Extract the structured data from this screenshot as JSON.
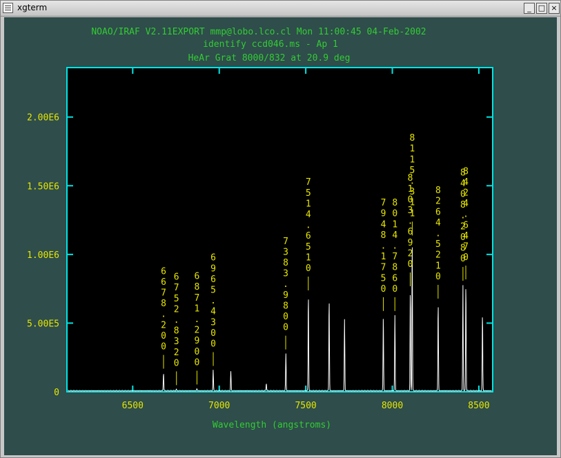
{
  "window": {
    "title": "xgterm",
    "buttons": [
      {
        "name": "minimize",
        "glyph": "_"
      },
      {
        "name": "maximize",
        "glyph": "□"
      },
      {
        "name": "close",
        "glyph": "×"
      }
    ]
  },
  "plot": {
    "header_lines": [
      "NOAO/IRAF V2.11EXPORT mmp@lobo.lco.cl Mon 11:00:45 04-Feb-2002",
      "identify ccd046.ms - Ap 1",
      "HeAr Grat 8000/832 at 20.9 deg"
    ],
    "xlabel": "Wavelength (angstroms)"
  },
  "chart_data": {
    "type": "line",
    "title": "HeAr Grat 8000/832 at 20.9 deg",
    "xlabel": "Wavelength (angstroms)",
    "ylabel": "",
    "xlim": [
      6120,
      8580
    ],
    "ylim": [
      0,
      2360000
    ],
    "x_ticks": [
      6500,
      7000,
      7500,
      8000,
      8500
    ],
    "y_ticks": [
      0,
      500000,
      1000000,
      1500000,
      2000000
    ],
    "y_tick_labels": [
      "0",
      "5.00E5",
      "1.00E6",
      "1.50E6",
      "2.00E6"
    ],
    "line_ids": [
      {
        "wavelength": 6678.2,
        "label": "6678.200"
      },
      {
        "wavelength": 6752.832,
        "label": "6752.8320"
      },
      {
        "wavelength": 6871.29,
        "label": "6871.2900"
      },
      {
        "wavelength": 6965.43,
        "label": "6965.4300"
      },
      {
        "wavelength": 7383.98,
        "label": "7383.9800"
      },
      {
        "wavelength": 7514.651,
        "label": "7514.6510"
      },
      {
        "wavelength": 7948.175,
        "label": "7948.1750"
      },
      {
        "wavelength": 8014.786,
        "label": "8014.7860"
      },
      {
        "wavelength": 8115.311,
        "label": "8115.311"
      },
      {
        "wavelength": 8103.692,
        "label": "8103.6920"
      },
      {
        "wavelength": 8264.521,
        "label": "8264.5210"
      },
      {
        "wavelength": 8408.21,
        "label": "8408.2080"
      },
      {
        "wavelength": 8424.648,
        "label": "8424.6470"
      }
    ],
    "peaks": [
      {
        "x": 6678,
        "y": 130000
      },
      {
        "x": 6752,
        "y": 10000
      },
      {
        "x": 6871,
        "y": 15000
      },
      {
        "x": 6965,
        "y": 150000
      },
      {
        "x": 7067,
        "y": 140000
      },
      {
        "x": 7272,
        "y": 55000
      },
      {
        "x": 7385,
        "y": 270000
      },
      {
        "x": 7515,
        "y": 700000
      },
      {
        "x": 7635,
        "y": 670000
      },
      {
        "x": 7724,
        "y": 520000
      },
      {
        "x": 7948,
        "y": 550000
      },
      {
        "x": 8015,
        "y": 550000
      },
      {
        "x": 8104,
        "y": 730000
      },
      {
        "x": 8115,
        "y": 1100000
      },
      {
        "x": 8265,
        "y": 640000
      },
      {
        "x": 8408,
        "y": 770000
      },
      {
        "x": 8425,
        "y": 780000
      },
      {
        "x": 8521,
        "y": 560000
      }
    ],
    "baseline": 8000
  },
  "colors": {
    "background": "#2e4d4b",
    "axes": "#00e5e5",
    "header_text": "#33cc33",
    "tick_labels": "#e6e600",
    "spectrum": "#ffffff",
    "line_ids": "#e6e600"
  }
}
